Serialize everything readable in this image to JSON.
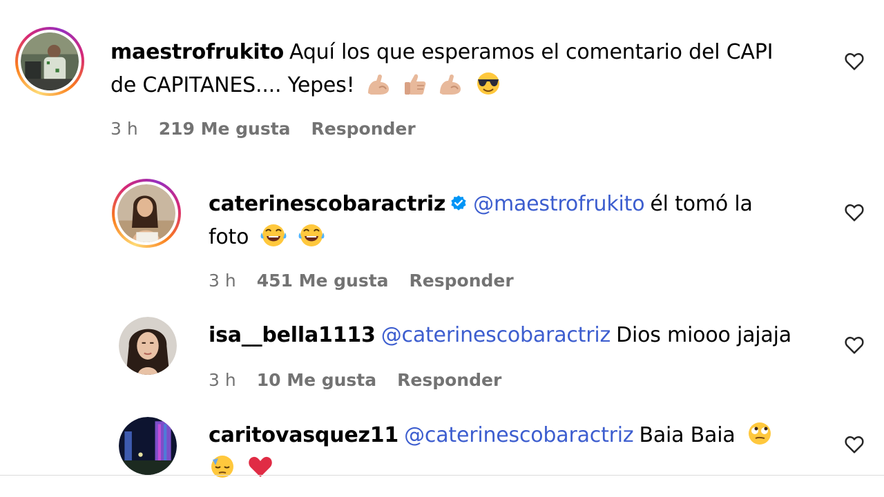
{
  "comments": [
    {
      "username": "maestrofrukito",
      "text": "Aquí los que esperamos el comentario del CAPI",
      "text2": "de CAPITANES.... Yepes!",
      "time": "3 h",
      "likes": "219 Me gusta",
      "reply": "Responder",
      "emojis": [
        "flexed-biceps",
        "thumbs-up",
        "flexed-biceps",
        "smiling-face-with-sunglasses"
      ]
    },
    {
      "username": "caterinescobaractriz",
      "verified": true,
      "mention": "@maestrofrukito",
      "text": "él tomó la",
      "text2": "foto",
      "time": "3 h",
      "likes": "451 Me gusta",
      "reply": "Responder",
      "emojis": [
        "face-with-tears-of-joy",
        "face-with-tears-of-joy"
      ]
    },
    {
      "username": "isa__bella1113",
      "mention": "@caterinescobaractriz",
      "text": "Dios miooo jajaja",
      "time": "3 h",
      "likes": "10 Me gusta",
      "reply": "Responder"
    },
    {
      "username": "caritovasquez11",
      "mention": "@caterinescobaractriz",
      "text": "Baia Baia",
      "emojis": [
        "face-with-rolling-eyes",
        "downcast-face-with-sweat",
        "red-heart"
      ]
    }
  ],
  "colors": {
    "mention": "#3d5ecf",
    "meta": "#737373",
    "verified": "#0095f6"
  },
  "icons": {
    "like": "heart-outline-icon"
  }
}
